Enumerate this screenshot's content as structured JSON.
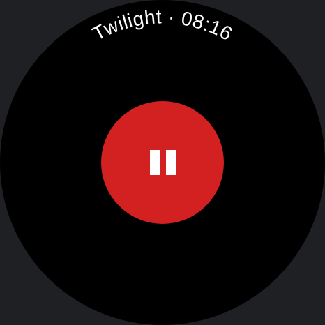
{
  "header": {
    "title": "Twilight",
    "separator": " · ",
    "time": "08:16"
  },
  "record_button": {
    "state": "recording",
    "icon": "pause-icon",
    "color": "#d32020"
  },
  "colors": {
    "face": "#000000",
    "bezel": "#1f2024",
    "text": "#ffffff"
  }
}
